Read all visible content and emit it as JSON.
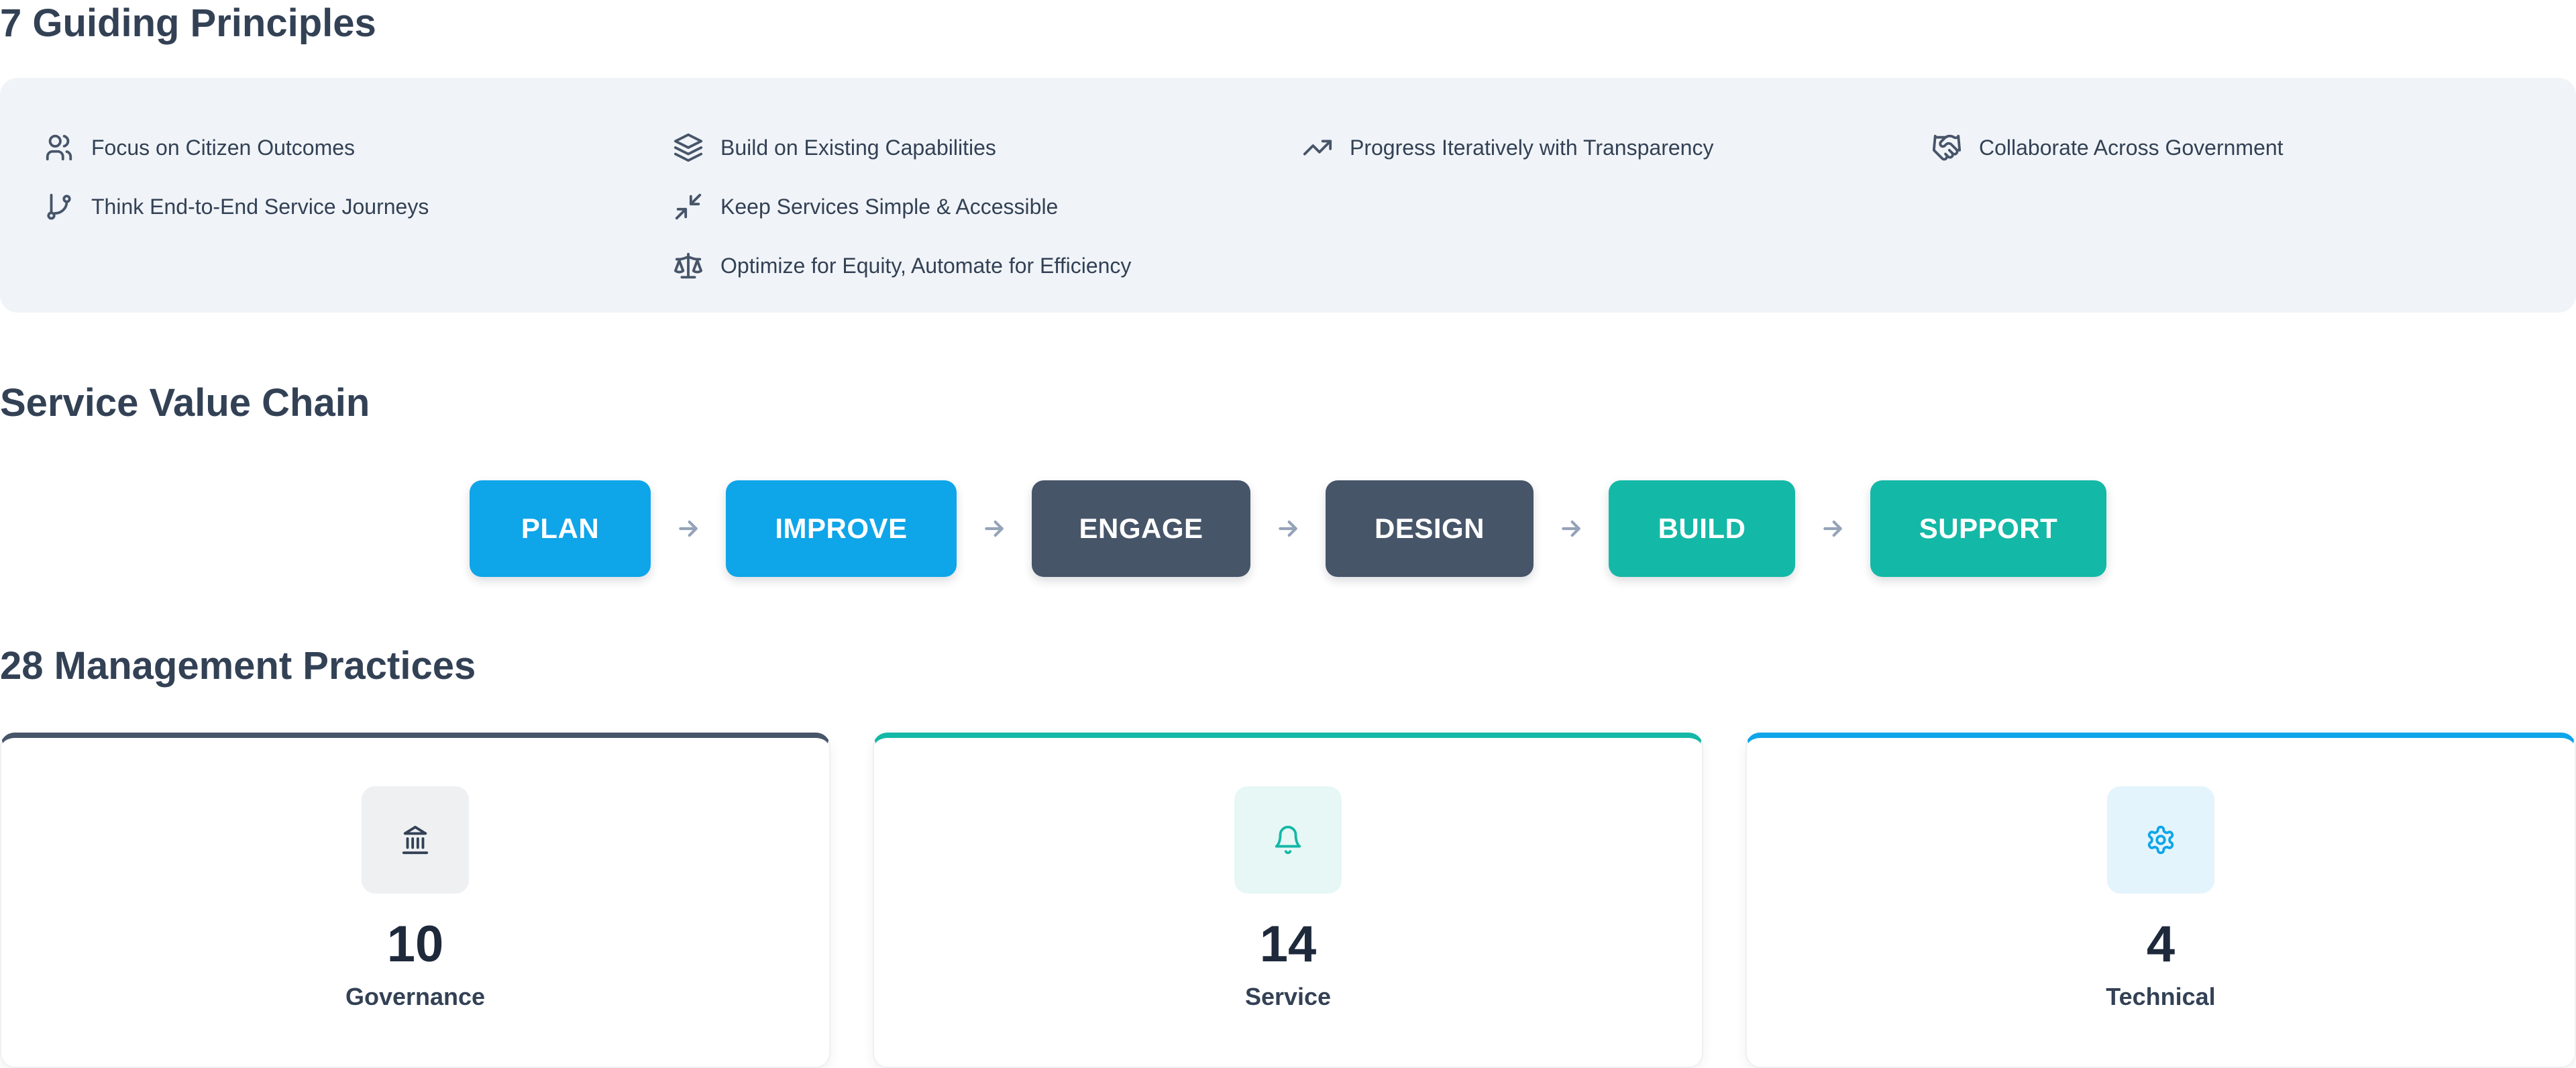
{
  "principles_section": {
    "title": "7 Guiding Principles",
    "items": [
      {
        "label": "Focus on Citizen Outcomes",
        "icon": "users-icon"
      },
      {
        "label": "Think End-to-End Service Journeys",
        "icon": "git-branch-icon"
      },
      {
        "label": "Build on Existing Capabilities",
        "icon": "layers-icon"
      },
      {
        "label": "Keep Services Simple & Accessible",
        "icon": "minimize-icon"
      },
      {
        "label": "Optimize for Equity, Automate for Efficiency",
        "icon": "scale-icon"
      },
      {
        "label": "Progress Iteratively with Transparency",
        "icon": "trending-up-icon"
      },
      {
        "label": "Collaborate Across Government",
        "icon": "handshake-icon"
      }
    ]
  },
  "chain_section": {
    "title": "Service Value Chain",
    "steps": [
      {
        "label": "PLAN",
        "color": "#0ea5e9"
      },
      {
        "label": "IMPROVE",
        "color": "#0ea5e9"
      },
      {
        "label": "ENGAGE",
        "color": "#475569"
      },
      {
        "label": "DESIGN",
        "color": "#475569"
      },
      {
        "label": "BUILD",
        "color": "#14b8a6"
      },
      {
        "label": "SUPPORT",
        "color": "#14b8a6"
      }
    ]
  },
  "practices_section": {
    "title": "28 Management Practices",
    "cards": [
      {
        "count": "10",
        "label": "Governance",
        "icon": "landmark-icon",
        "accent": "#475569",
        "badge_bg": "#eef0f2"
      },
      {
        "count": "14",
        "label": "Service",
        "icon": "bell-icon",
        "accent": "#14b8a6",
        "badge_bg": "#e6f7f5"
      },
      {
        "count": "4",
        "label": "Technical",
        "icon": "gear-icon",
        "accent": "#0ea5e9",
        "badge_bg": "#e3f4fc"
      }
    ]
  }
}
